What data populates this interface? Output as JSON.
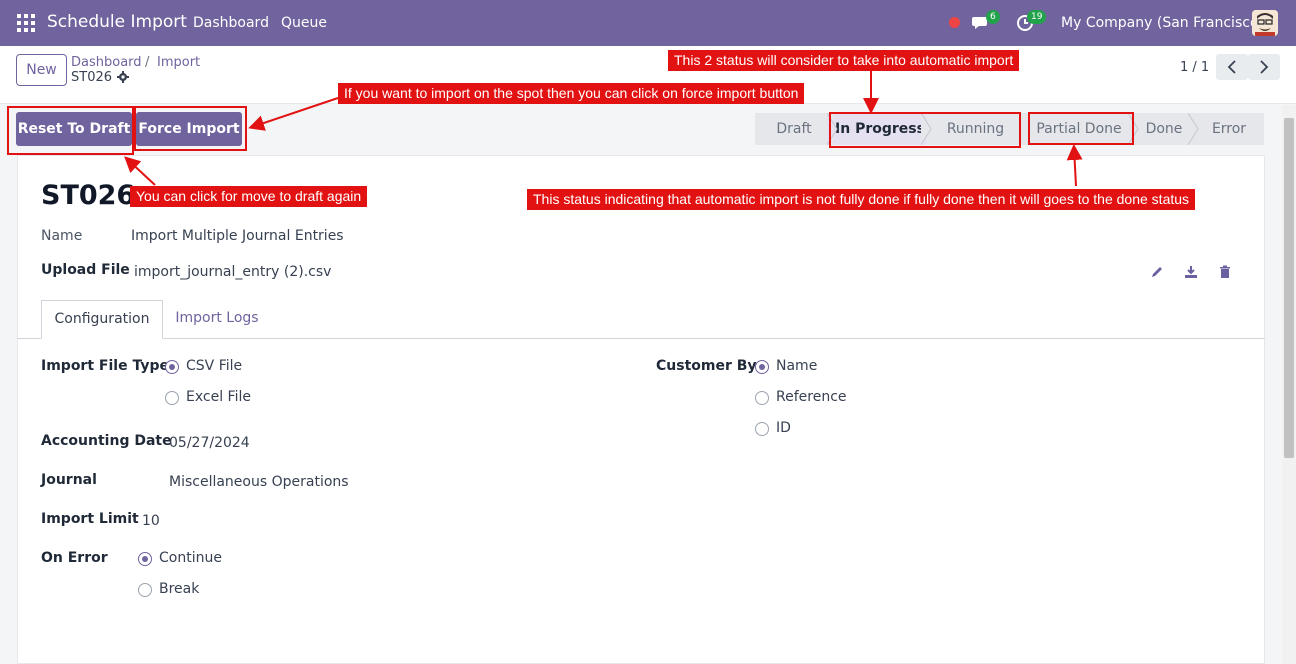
{
  "navbar": {
    "app_title": "Schedule Import",
    "menu": [
      "Dashboard",
      "Queue"
    ],
    "messages_count": "6",
    "activities_count": "19",
    "company": "My Company (San Francisco)"
  },
  "control_panel": {
    "new_label": "New",
    "breadcrumb": [
      "Dashboard",
      "Import"
    ],
    "breadcrumb_sep": "/",
    "current_record": "ST026",
    "pager": "1 / 1"
  },
  "actions": {
    "reset_to_draft": "Reset To Draft",
    "force_import": "Force Import"
  },
  "statusbar": {
    "stages": [
      "Draft",
      "In Progress",
      "Running",
      "Partial Done",
      "Done",
      "Error"
    ],
    "active_stage": "In Progress"
  },
  "record": {
    "title": "ST026",
    "name_label": "Name",
    "name_value": "Import Multiple Journal Entries",
    "upload_label": "Upload File",
    "upload_value": "import_journal_entry (2).csv"
  },
  "tabs": [
    "Configuration",
    "Import Logs"
  ],
  "config": {
    "file_type_label": "Import File Type",
    "file_type_options": [
      "CSV File",
      "Excel File"
    ],
    "file_type_selected": "CSV File",
    "accounting_date_label": "Accounting Date",
    "accounting_date_value": "05/27/2024",
    "journal_label": "Journal",
    "journal_value": "Miscellaneous Operations",
    "import_limit_label": "Import Limit",
    "import_limit_value": "10",
    "on_error_label": "On Error",
    "on_error_options": [
      "Continue",
      "Break"
    ],
    "on_error_selected": "Continue",
    "customer_by_label": "Customer By",
    "customer_by_options": [
      "Name",
      "Reference",
      "ID"
    ],
    "customer_by_selected": "Name"
  },
  "annotations": {
    "status_auto": "This 2 status will consider to take into automatic import",
    "force_import": "If you want to import on the spot then you can click on force import button",
    "reset_draft": "You can click for move to draft again",
    "partial_done": "This status indicating that automatic import is not fully done if fully done then it will goes to the done status"
  },
  "colors": {
    "brand": "#71639e",
    "annotation_red": "#e21212",
    "badge_green": "#22a34b"
  }
}
